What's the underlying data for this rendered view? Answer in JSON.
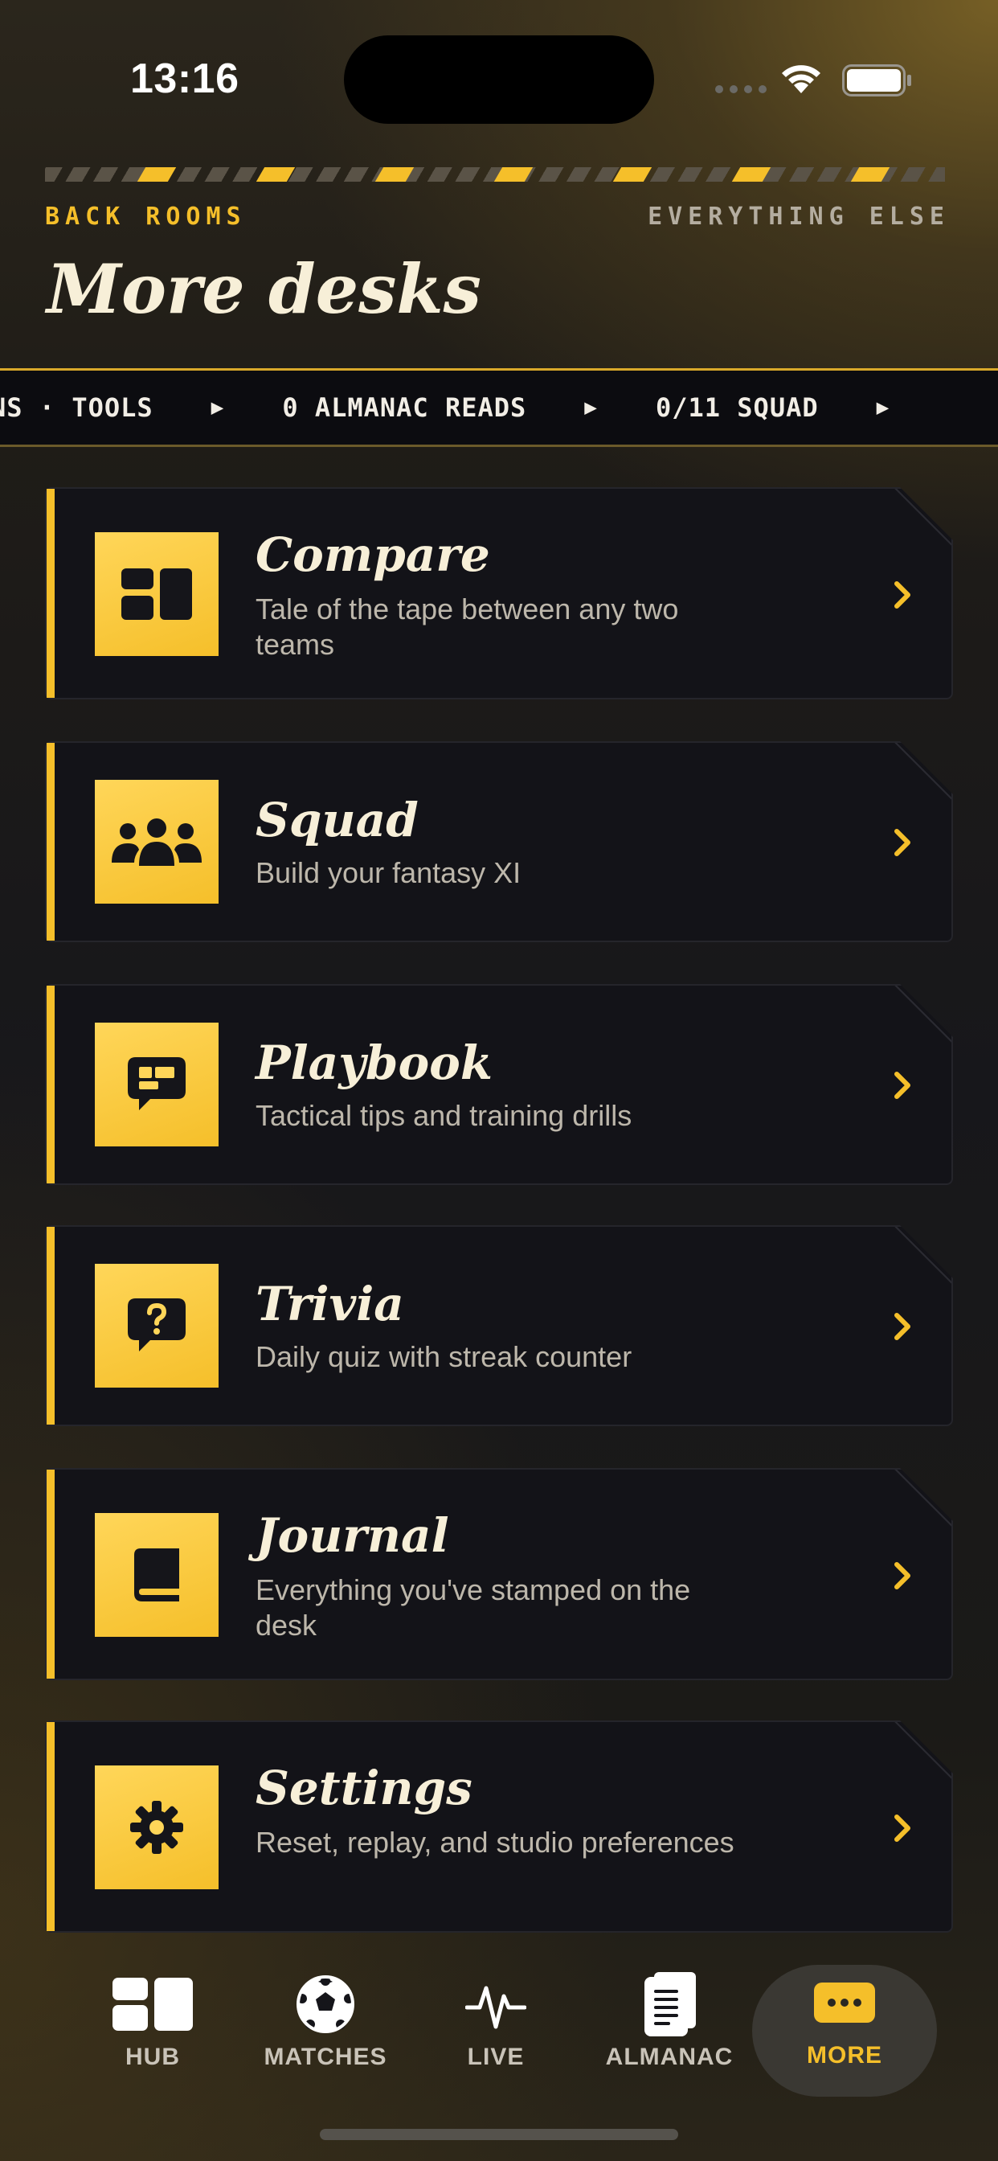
{
  "status_bar": {
    "time": "13:16"
  },
  "header": {
    "eyebrow_left": "BACK ROOMS",
    "eyebrow_right": "EVERYTHING ELSE",
    "title": "More desks"
  },
  "ticker": {
    "items": [
      "NS · TOOLS",
      "0 ALMANAC READS",
      "0/11 SQUAD"
    ],
    "separator": "▶"
  },
  "cards": [
    {
      "title": "Compare",
      "subtitle": "Tale of the tape between any two teams",
      "icon": "compare-icon"
    },
    {
      "title": "Squad",
      "subtitle": "Build your fantasy XI",
      "icon": "people-icon"
    },
    {
      "title": "Playbook",
      "subtitle": "Tactical tips and training drills",
      "icon": "chat-board-icon"
    },
    {
      "title": "Trivia",
      "subtitle": "Daily quiz with streak counter",
      "icon": "question-bubble-icon"
    },
    {
      "title": "Journal",
      "subtitle": "Everything you've stamped on the desk",
      "icon": "book-icon"
    },
    {
      "title": "Settings",
      "subtitle": "Reset, replay, and studio preferences",
      "icon": "gear-icon"
    }
  ],
  "tabs": [
    {
      "label": "HUB",
      "icon": "hub-icon"
    },
    {
      "label": "MATCHES",
      "icon": "soccer-ball-icon"
    },
    {
      "label": "LIVE",
      "icon": "pulse-icon"
    },
    {
      "label": "ALMANAC",
      "icon": "document-icon"
    },
    {
      "label": "MORE",
      "icon": "more-icon",
      "active": true
    }
  ],
  "colors": {
    "accent": "#f5bf2a",
    "card_bg": "#131318",
    "title_text": "#f7efd8"
  }
}
